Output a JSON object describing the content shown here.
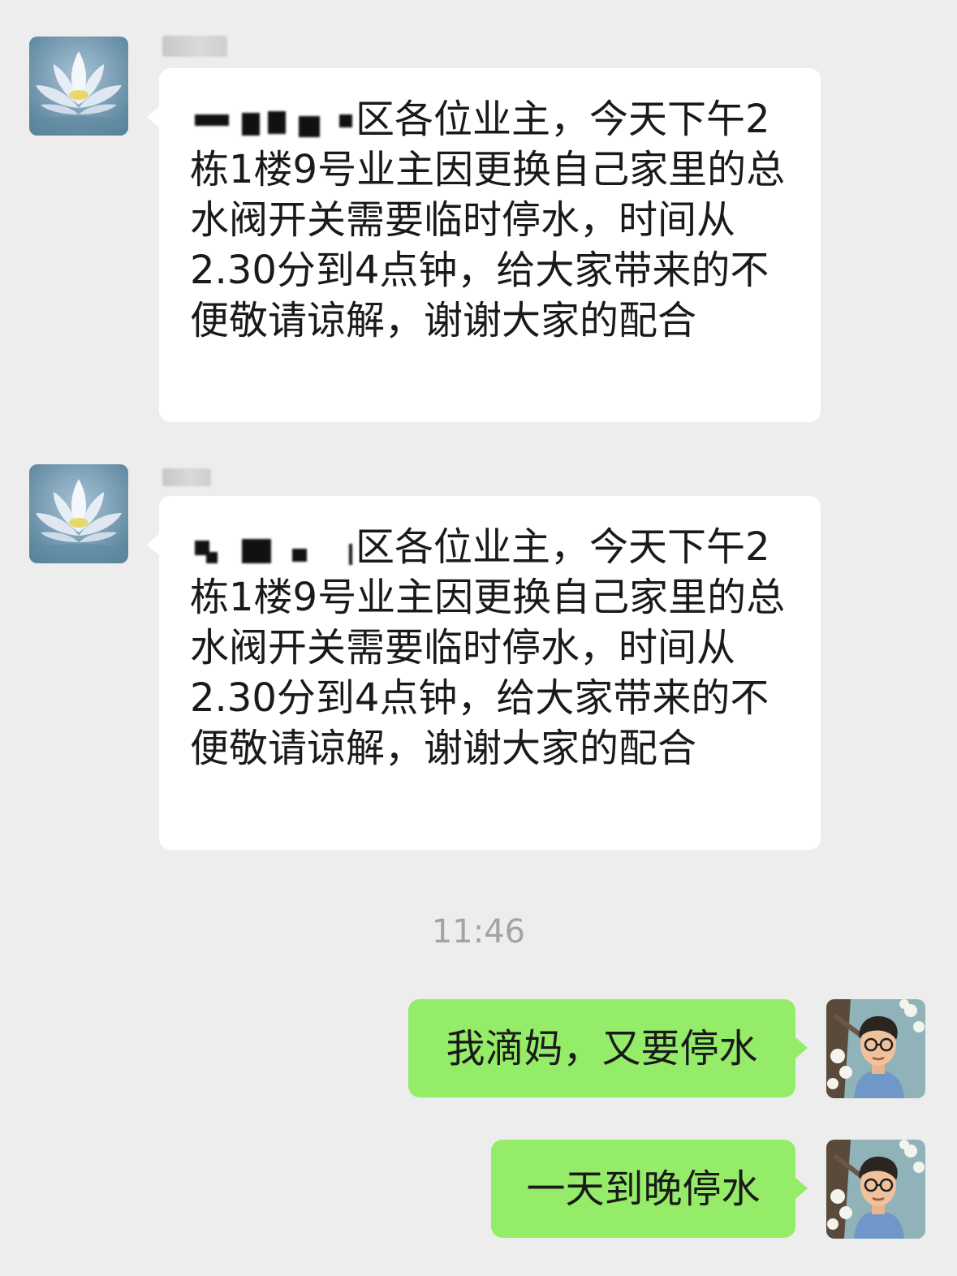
{
  "messages": [
    {
      "direction": "incoming",
      "sender_avatar": "white-lotus-avatar",
      "text": "区各位业主，今天下午2栋1楼9号业主因更换自己家里的总水阀开关需要临时停水，时间从2.30分到4点钟，给大家带来的不便敬请谅解，谢谢大家的配合"
    },
    {
      "direction": "incoming",
      "sender_avatar": "white-lotus-avatar",
      "text": "区各位业主，今天下午2栋1楼9号业主因更换自己家里的总水阀开关需要临时停水，时间从2.30分到4点钟，给大家带来的不便敬请谅解，谢谢大家的配合"
    }
  ],
  "timestamp": "11:46",
  "outgoing": [
    {
      "direction": "outgoing",
      "sender_avatar": "cartoon-man-glasses-avatar",
      "text": "我滴妈，又要停水"
    },
    {
      "direction": "outgoing",
      "sender_avatar": "cartoon-man-glasses-avatar",
      "text": "一天到晚停水"
    }
  ],
  "colors": {
    "background": "#ededed",
    "incoming_bubble": "#ffffff",
    "outgoing_bubble": "#95ec69",
    "timestamp": "#a3a3a3"
  }
}
